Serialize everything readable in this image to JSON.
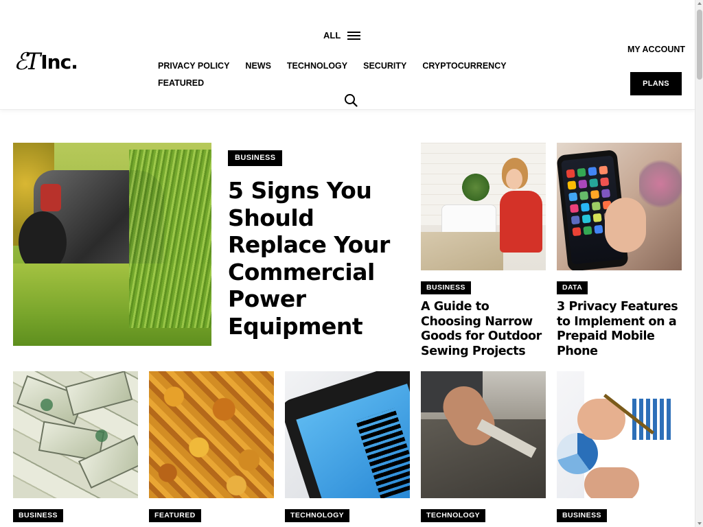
{
  "brand": {
    "logo_mark": "ℰT",
    "logo_word": "Inc."
  },
  "header": {
    "all_label": "ALL",
    "nav": [
      "PRIVACY POLICY",
      "NEWS",
      "TECHNOLOGY",
      "SECURITY",
      "CRYPTOCURRENCY",
      "FEATURED"
    ],
    "my_account": "MY ACCOUNT",
    "plans": "PLANS"
  },
  "featured": {
    "category": "BUSINESS",
    "title": "5 Signs You Should Replace Your Commercial Power Equipment"
  },
  "side_posts": [
    {
      "category": "BUSINESS",
      "title": "A Guide to Choosing Narrow Goods for Outdoor Sewing Projects"
    },
    {
      "category": "DATA",
      "title": "3 Privacy Features to Implement on a Prepaid Mobile Phone"
    }
  ],
  "bottom_posts": [
    {
      "category": "BUSINESS"
    },
    {
      "category": "FEATURED"
    },
    {
      "category": "TECHNOLOGY"
    },
    {
      "category": "TECHNOLOGY"
    },
    {
      "category": "BUSINESS"
    }
  ],
  "icons": {
    "menu": "hamburger-icon",
    "search": "search-icon"
  },
  "colors": {
    "badge_bg": "#000000",
    "badge_text": "#ffffff",
    "text": "#000000"
  }
}
